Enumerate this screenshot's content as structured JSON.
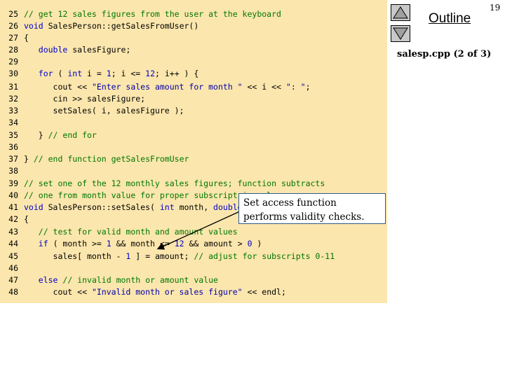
{
  "outline": {
    "label": "Outline",
    "file": "salesp.cpp (2 of 3)",
    "page": "19"
  },
  "callout": {
    "text": "Set access function performs validity checks."
  },
  "code": [
    {
      "n": "25",
      "segs": [
        [
          "cm",
          "// get 12 sales figures from the user at the keyboard"
        ]
      ]
    },
    {
      "n": "26",
      "segs": [
        [
          "kw",
          "void"
        ],
        [
          "",
          " SalesPerson::getSalesFromUser()"
        ]
      ]
    },
    {
      "n": "27",
      "segs": [
        [
          "",
          "{"
        ]
      ]
    },
    {
      "n": "28",
      "segs": [
        [
          "",
          "   "
        ],
        [
          "kw",
          "double"
        ],
        [
          "",
          " salesFigure;"
        ]
      ]
    },
    {
      "n": "29",
      "segs": []
    },
    {
      "n": "30",
      "segs": [
        [
          "",
          "   "
        ],
        [
          "kw",
          "for"
        ],
        [
          "",
          " ( "
        ],
        [
          "kw",
          "int"
        ],
        [
          "",
          " i = "
        ],
        [
          "nm",
          "1"
        ],
        [
          "",
          "; i <= "
        ],
        [
          "nm",
          "12"
        ],
        [
          "",
          "; i++ ) {"
        ]
      ]
    },
    {
      "n": "31",
      "segs": [
        [
          "",
          "      cout << "
        ],
        [
          "st",
          "\"Enter sales amount for month \""
        ],
        [
          "",
          " << i << "
        ],
        [
          "st",
          "\": \""
        ],
        [
          "",
          ";"
        ]
      ]
    },
    {
      "n": "32",
      "segs": [
        [
          "",
          "      cin >> salesFigure;"
        ]
      ]
    },
    {
      "n": "33",
      "segs": [
        [
          "",
          "      setSales( i, salesFigure );"
        ]
      ]
    },
    {
      "n": "34",
      "segs": []
    },
    {
      "n": "35",
      "segs": [
        [
          "",
          "   } "
        ],
        [
          "cm",
          "// end for"
        ]
      ]
    },
    {
      "n": "36",
      "segs": []
    },
    {
      "n": "37",
      "segs": [
        [
          "",
          "} "
        ],
        [
          "cm",
          "// end function getSalesFromUser"
        ]
      ]
    },
    {
      "n": "38",
      "segs": []
    },
    {
      "n": "39",
      "segs": [
        [
          "cm",
          "// set one of the 12 monthly sales figures; function subtracts"
        ]
      ]
    },
    {
      "n": "40",
      "segs": [
        [
          "cm",
          "// one from month value for proper subscript in sales array"
        ]
      ]
    },
    {
      "n": "41",
      "segs": [
        [
          "kw",
          "void"
        ],
        [
          "",
          " SalesPerson::setSales( "
        ],
        [
          "kw",
          "int"
        ],
        [
          "",
          " month, "
        ],
        [
          "kw",
          "double"
        ],
        [
          "",
          " amount )"
        ]
      ]
    },
    {
      "n": "42",
      "segs": [
        [
          "",
          "{"
        ]
      ]
    },
    {
      "n": "43",
      "segs": [
        [
          "",
          "   "
        ],
        [
          "cm",
          "// test for valid month and amount values"
        ]
      ]
    },
    {
      "n": "44",
      "segs": [
        [
          "",
          "   "
        ],
        [
          "kw",
          "if"
        ],
        [
          "",
          " ( month >= "
        ],
        [
          "nm",
          "1"
        ],
        [
          "",
          " && month <= "
        ],
        [
          "nm",
          "12"
        ],
        [
          "",
          " && amount > "
        ],
        [
          "nm",
          "0"
        ],
        [
          "",
          " )"
        ]
      ]
    },
    {
      "n": "45",
      "segs": [
        [
          "",
          "      sales[ month - "
        ],
        [
          "nm",
          "1"
        ],
        [
          "",
          " ] = amount; "
        ],
        [
          "cm",
          "// adjust for subscripts 0-11"
        ]
      ]
    },
    {
      "n": "46",
      "segs": []
    },
    {
      "n": "47",
      "segs": [
        [
          "",
          "   "
        ],
        [
          "kw",
          "else"
        ],
        [
          "",
          " "
        ],
        [
          "cm",
          "// invalid month or amount value"
        ]
      ]
    },
    {
      "n": "48",
      "segs": [
        [
          "",
          "      cout << "
        ],
        [
          "st",
          "\"Invalid month or sales figure\""
        ],
        [
          "",
          " << endl;"
        ]
      ]
    }
  ]
}
